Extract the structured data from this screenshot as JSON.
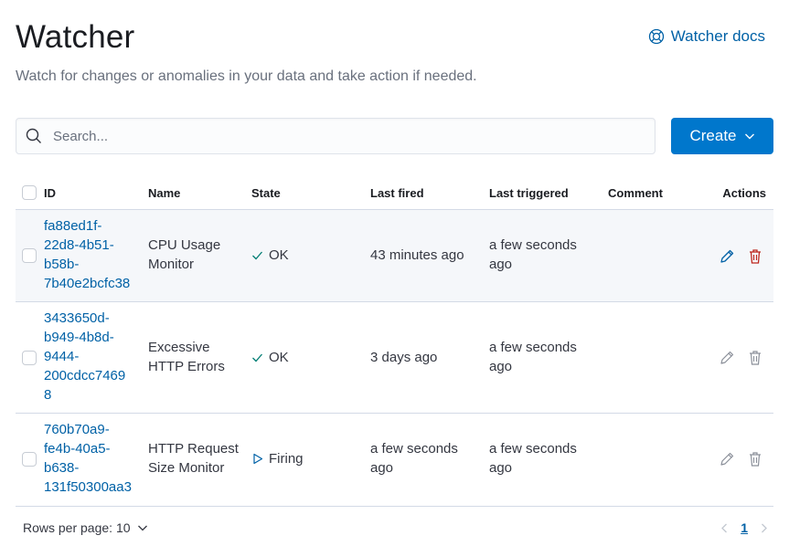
{
  "header": {
    "title": "Watcher",
    "docs_link": "Watcher docs",
    "subtitle": "Watch for changes or anomalies in your data and take action if needed."
  },
  "toolbar": {
    "search_placeholder": "Search...",
    "search_value": "",
    "create_label": "Create"
  },
  "table": {
    "columns": [
      "ID",
      "Name",
      "State",
      "Last fired",
      "Last triggered",
      "Comment",
      "Actions"
    ],
    "rows": [
      {
        "id_lines": [
          "fa88ed1f-",
          "22d8-4b51-",
          "b58b-",
          "7b40e2bcfc38"
        ],
        "name_lines": [
          "CPU Usage",
          "Monitor"
        ],
        "state": "OK",
        "state_icon": "check-icon",
        "last_fired_lines": [
          "43 minutes ago"
        ],
        "last_triggered_lines": [
          "a few seconds",
          "ago"
        ],
        "comment": ""
      },
      {
        "id_lines": [
          "3433650d-",
          "b949-4b8d-",
          "9444-",
          "200cdcc7469",
          "8"
        ],
        "name_lines": [
          "Excessive",
          "HTTP Errors"
        ],
        "state": "OK",
        "state_icon": "check-icon",
        "last_fired_lines": [
          "3 days ago"
        ],
        "last_triggered_lines": [
          "a few seconds",
          "ago"
        ],
        "comment": ""
      },
      {
        "id_lines": [
          "760b70a9-",
          "fe4b-40a5-",
          "b638-",
          "131f50300aa3"
        ],
        "name_lines": [
          "HTTP Request",
          "Size Monitor"
        ],
        "state": "Firing",
        "state_icon": "play-icon",
        "last_fired_lines": [
          "a few seconds",
          "ago"
        ],
        "last_triggered_lines": [
          "a few seconds",
          "ago"
        ],
        "comment": ""
      }
    ]
  },
  "footer": {
    "rows_per_page": "Rows per page: 10",
    "current_page": "1"
  },
  "colors": {
    "primary": "#0077cc",
    "link": "#0061a6",
    "danger": "#bd271e",
    "muted": "#69707d"
  }
}
